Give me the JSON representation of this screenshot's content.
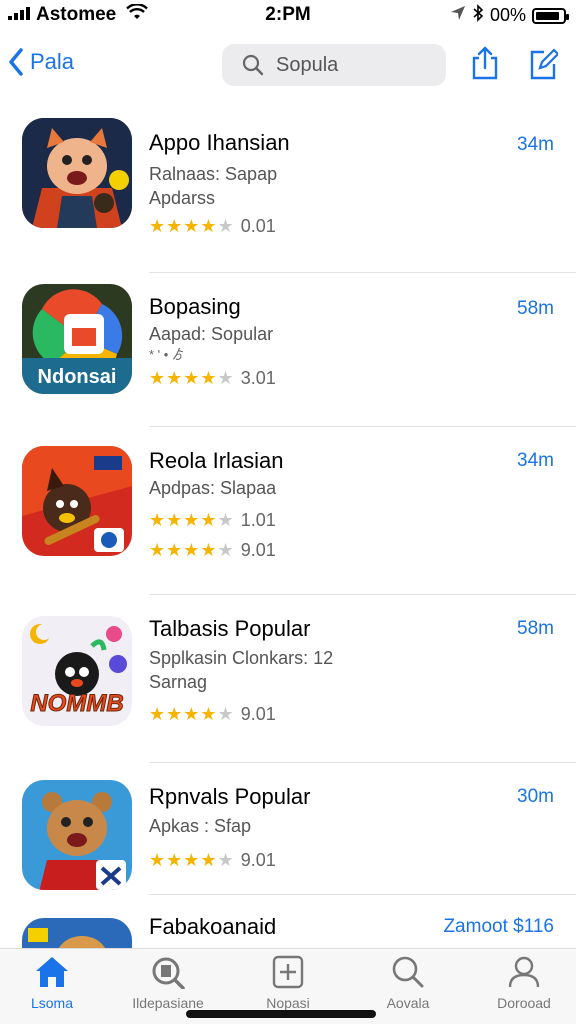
{
  "status_bar": {
    "carrier": "Astomee",
    "time": "2:PM",
    "battery": "00%",
    "battery_level": 0.9
  },
  "nav": {
    "back_label": "Pala",
    "search_placeholder": "Sopula"
  },
  "apps": [
    {
      "title": "Appo Ihansian",
      "subtitle1": "Ralnaas: Sapap",
      "subtitle2": "Apdarss",
      "rating_text": "0.01",
      "price": "34m",
      "stars": 4
    },
    {
      "title": "Bopasing",
      "subtitle1": "Aapad: Sopular",
      "subtitle2": "* ' • ゟ",
      "rating_text": "3.01",
      "price": "58m",
      "stars": 4
    },
    {
      "title": "Reola Irlasian",
      "subtitle1": "Apdpas: Slapaa",
      "rating_text": "1.01",
      "rating_text2": "9.01",
      "price": "34m",
      "stars": 4
    },
    {
      "title": "Talbasis Popular",
      "subtitle1": "Spplkasin Clonkars: 12",
      "subtitle2": "Sarnag",
      "rating_text": "9.01",
      "price": "58m",
      "stars": 4
    },
    {
      "title": "Rpnvals Popular",
      "subtitle1": "Apkas : Sfap",
      "rating_text": "9.01",
      "price": "30m",
      "stars": 4
    },
    {
      "title": "Fabakoanaid",
      "price": "Zamoot $116"
    }
  ],
  "icon_texts": {
    "app2": "Ndonsai",
    "app4": "NOMMB"
  },
  "tabs": [
    {
      "label": "Lsoma",
      "icon": "home-icon",
      "active": true
    },
    {
      "label": "Ildepasiane",
      "icon": "search-badge-icon"
    },
    {
      "label": "Nopasi",
      "icon": "add-square-icon"
    },
    {
      "label": "Aovala",
      "icon": "search-icon"
    },
    {
      "label": "Dorooad",
      "icon": "person-icon"
    }
  ],
  "colors": {
    "accent": "#1a73e8",
    "star": "#f5b400"
  }
}
